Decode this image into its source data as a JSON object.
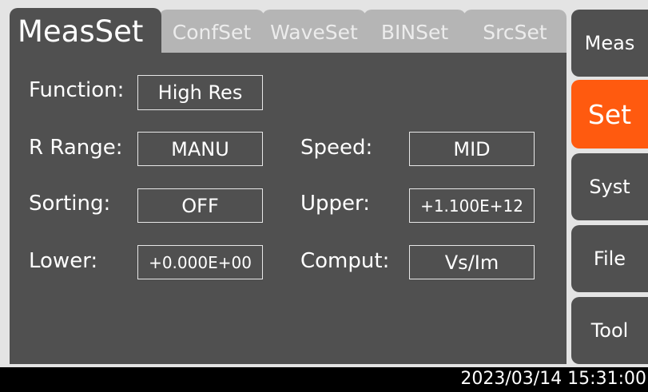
{
  "tabs": [
    {
      "label": "MeasSet"
    },
    {
      "label": "ConfSet"
    },
    {
      "label": "WaveSet"
    },
    {
      "label": "BINSet"
    },
    {
      "label": "SrcSet"
    }
  ],
  "fields": {
    "function": {
      "label": "Function:",
      "value": "High Res"
    },
    "r_range": {
      "label": "R Range:",
      "value": "MANU"
    },
    "speed": {
      "label": "Speed:",
      "value": "MID"
    },
    "sorting": {
      "label": "Sorting:",
      "value": "OFF"
    },
    "upper": {
      "label": "Upper:",
      "value": "+1.100E+12"
    },
    "lower": {
      "label": "Lower:",
      "value": "+0.000E+00"
    },
    "comput": {
      "label": "Comput:",
      "value": "Vs/Im"
    }
  },
  "sidebar": [
    {
      "label": "Meas"
    },
    {
      "label": "Set"
    },
    {
      "label": "Syst"
    },
    {
      "label": "File"
    },
    {
      "label": "Tool"
    }
  ],
  "status": {
    "datetime": "2023/03/14 15:31:00"
  },
  "colors": {
    "accent": "#ff5a0f",
    "panel": "#505050",
    "tab_inactive": "#b5b5b5",
    "background": "#e4e4e4"
  }
}
